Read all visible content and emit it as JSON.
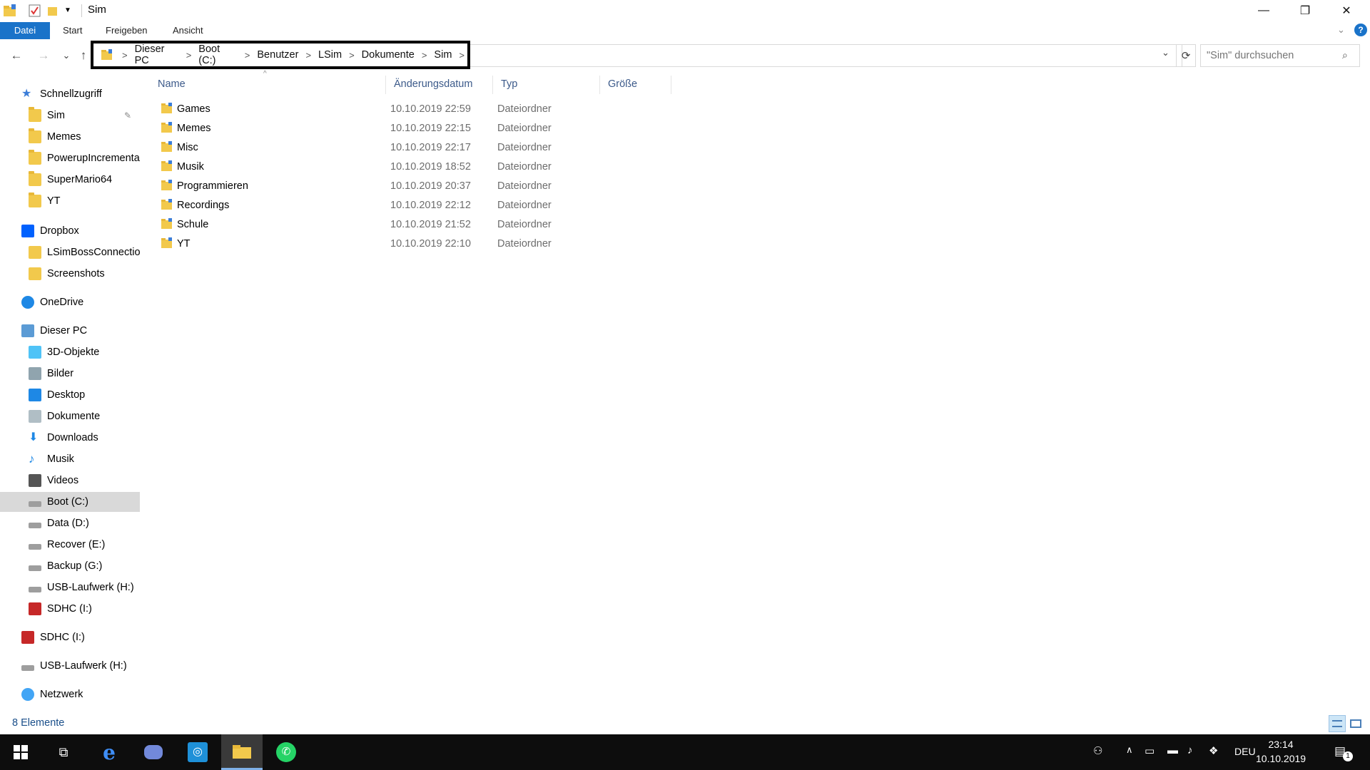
{
  "window": {
    "title": "Sim",
    "controls": {
      "minimize": "—",
      "maximize": "❐",
      "close": "✕"
    }
  },
  "ribbon": {
    "tabs": [
      {
        "label": "Datei",
        "active": true
      },
      {
        "label": "Start"
      },
      {
        "label": "Freigeben"
      },
      {
        "label": "Ansicht"
      }
    ],
    "help": "?"
  },
  "nav": {
    "back": "←",
    "forward": "→",
    "recent": "⌄",
    "up": "↑"
  },
  "address": {
    "crumbs": [
      "Dieser PC",
      "Boot (C:)",
      "Benutzer",
      "LSim",
      "Dokumente",
      "Sim"
    ],
    "separator": ">"
  },
  "search": {
    "placeholder": "\"Sim\" durchsuchen"
  },
  "sidebar": {
    "items": [
      {
        "label": "Schnellzugriff",
        "level": 0,
        "icon": "star-icon"
      },
      {
        "label": "Sim",
        "level": 1,
        "icon": "folder-icon",
        "pinned": true
      },
      {
        "label": "Memes",
        "level": 1,
        "icon": "folder-icon"
      },
      {
        "label": "PowerupIncrementa",
        "level": 1,
        "icon": "folder-icon"
      },
      {
        "label": "SuperMario64",
        "level": 1,
        "icon": "folder-icon"
      },
      {
        "label": "YT",
        "level": 1,
        "icon": "folder-icon"
      },
      {
        "label": "Dropbox",
        "level": 0,
        "icon": "dropbox-icon"
      },
      {
        "label": "LSimBossConnectio",
        "level": 1,
        "icon": "shared-folder-icon"
      },
      {
        "label": "Screenshots",
        "level": 1,
        "icon": "synced-folder-icon"
      },
      {
        "label": "OneDrive",
        "level": 0,
        "icon": "cloud-icon"
      },
      {
        "label": "Dieser PC",
        "level": 0,
        "icon": "computer-icon"
      },
      {
        "label": "3D-Objekte",
        "level": 1,
        "icon": "cube-icon"
      },
      {
        "label": "Bilder",
        "level": 1,
        "icon": "pictures-icon"
      },
      {
        "label": "Desktop",
        "level": 1,
        "icon": "desktop-icon"
      },
      {
        "label": "Dokumente",
        "level": 1,
        "icon": "documents-icon"
      },
      {
        "label": "Downloads",
        "level": 1,
        "icon": "download-icon"
      },
      {
        "label": "Musik",
        "level": 1,
        "icon": "music-icon"
      },
      {
        "label": "Videos",
        "level": 1,
        "icon": "video-icon"
      },
      {
        "label": "Boot (C:)",
        "level": 1,
        "icon": "windows-drive-icon",
        "selected": true
      },
      {
        "label": "Data (D:)",
        "level": 1,
        "icon": "drive-icon"
      },
      {
        "label": "Recover (E:)",
        "level": 1,
        "icon": "drive-icon"
      },
      {
        "label": "Backup (G:)",
        "level": 1,
        "icon": "drive-icon"
      },
      {
        "label": "USB-Laufwerk (H:)",
        "level": 1,
        "icon": "drive-icon"
      },
      {
        "label": "SDHC (I:)",
        "level": 1,
        "icon": "sd-card-icon"
      },
      {
        "label": "SDHC (I:)",
        "level": 0,
        "icon": "sd-card-icon"
      },
      {
        "label": "USB-Laufwerk (H:)",
        "level": 0,
        "icon": "drive-icon"
      },
      {
        "label": "Netzwerk",
        "level": 0,
        "icon": "network-icon"
      }
    ]
  },
  "columns": {
    "name": "Name",
    "date": "Änderungsdatum",
    "type": "Typ",
    "size": "Größe"
  },
  "files": [
    {
      "name": "Games",
      "date": "10.10.2019 22:59",
      "type": "Dateiordner"
    },
    {
      "name": "Memes",
      "date": "10.10.2019 22:15",
      "type": "Dateiordner"
    },
    {
      "name": "Misc",
      "date": "10.10.2019 22:17",
      "type": "Dateiordner"
    },
    {
      "name": "Musik",
      "date": "10.10.2019 18:52",
      "type": "Dateiordner"
    },
    {
      "name": "Programmieren",
      "date": "10.10.2019 20:37",
      "type": "Dateiordner"
    },
    {
      "name": "Recordings",
      "date": "10.10.2019 22:12",
      "type": "Dateiordner"
    },
    {
      "name": "Schule",
      "date": "10.10.2019 21:52",
      "type": "Dateiordner"
    },
    {
      "name": "YT",
      "date": "10.10.2019 22:10",
      "type": "Dateiordner"
    }
  ],
  "status": {
    "count": "8 Elemente"
  },
  "taskbar": {
    "language": "DEU",
    "time": "23:14",
    "date": "10.10.2019",
    "notifications": "1"
  },
  "colors": {
    "accent": "#1a73c9",
    "folder": "#f2c94c",
    "taskbar": "#0d0d0d",
    "selection": "#d9d9d9"
  }
}
